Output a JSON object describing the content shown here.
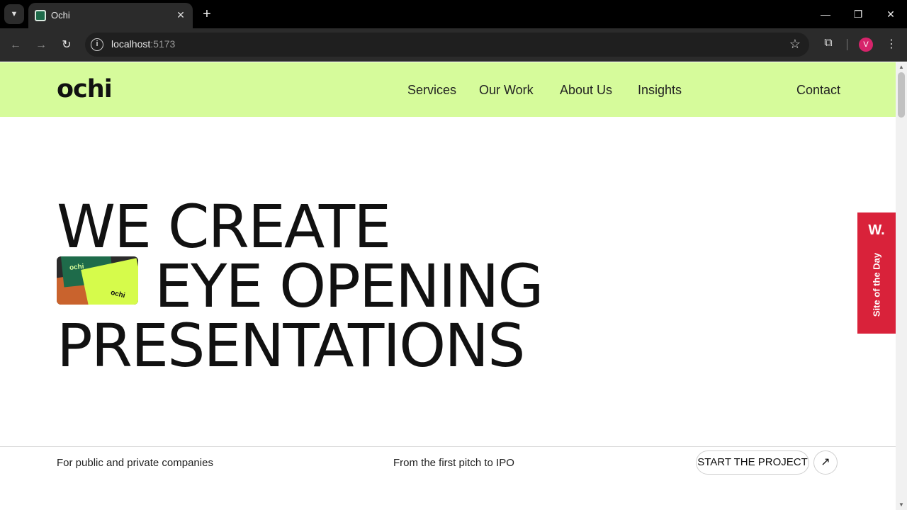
{
  "browser": {
    "tab_title": "Ochi",
    "url_host": "localhost",
    "url_port": ":5173",
    "avatar_letter": "V",
    "avatar_color": "#d6246b"
  },
  "site": {
    "logo": "ochi",
    "nav": [
      "Services",
      "Our Work",
      "About Us",
      "Insights"
    ],
    "contact": "Contact",
    "nav_bg": "#d6fb9b",
    "hero": {
      "line1": "WE CREATE",
      "line2": "EYE OPENING",
      "line3": "PRESENTATIONS",
      "image_labels": [
        "ochi",
        "ochi"
      ]
    },
    "footer": {
      "left": "For public and private companies",
      "middle": "From the first pitch to IPO",
      "cta": "START THE PROJECT",
      "cta_icon": "arrow-up-right-icon"
    },
    "award": {
      "logo": "W.",
      "label": "Site of the Day",
      "color": "#d9223a"
    }
  }
}
